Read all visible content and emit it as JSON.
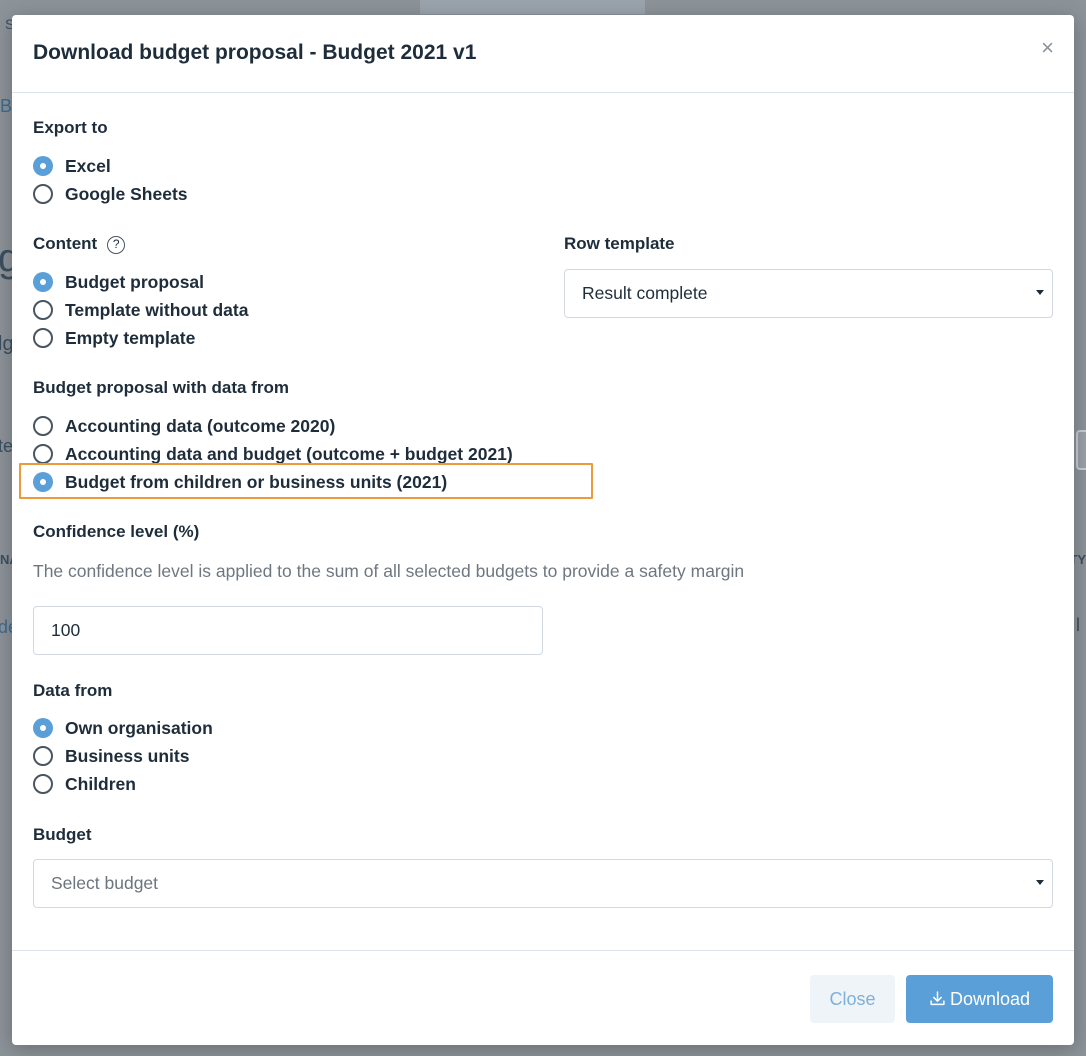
{
  "background": {
    "fragment_s": "S",
    "fragment_b": "B",
    "fragment_g": "g",
    "fragment_lg": "lg",
    "fragment_te": "te",
    "fragment_na": "NA",
    "fragment_de": "de",
    "fragment_ty": "TY",
    "fragment_l": "l"
  },
  "modal": {
    "title": "Download budget proposal - Budget 2021 v1",
    "close_glyph": "×"
  },
  "export_to": {
    "label": "Export to",
    "options": [
      {
        "label": "Excel",
        "checked": true
      },
      {
        "label": "Google Sheets",
        "checked": false
      }
    ]
  },
  "content": {
    "label": "Content",
    "help_glyph": "?",
    "options": [
      {
        "label": "Budget proposal",
        "checked": true
      },
      {
        "label": "Template without data",
        "checked": false
      },
      {
        "label": "Empty template",
        "checked": false
      }
    ]
  },
  "row_template": {
    "label": "Row template",
    "value": "Result complete"
  },
  "data_source": {
    "label": "Budget proposal with data from",
    "options": [
      {
        "label": "Accounting data (outcome 2020)",
        "checked": false
      },
      {
        "label": "Accounting data and budget (outcome + budget 2021)",
        "checked": false
      },
      {
        "label": "Budget from children or business units (2021)",
        "checked": true
      }
    ]
  },
  "confidence": {
    "label": "Confidence level (%)",
    "hint": "The confidence level is applied to the sum of all selected budgets to provide a safety margin",
    "value": "100"
  },
  "data_from": {
    "label": "Data from",
    "options": [
      {
        "label": "Own organisation",
        "checked": true
      },
      {
        "label": "Business units",
        "checked": false
      },
      {
        "label": "Children",
        "checked": false
      }
    ]
  },
  "budget": {
    "label": "Budget",
    "placeholder": "Select budget"
  },
  "footer": {
    "close_label": "Close",
    "download_label": "Download"
  },
  "colors": {
    "accent": "#5b9fd8",
    "highlight": "#ec9a3a"
  }
}
